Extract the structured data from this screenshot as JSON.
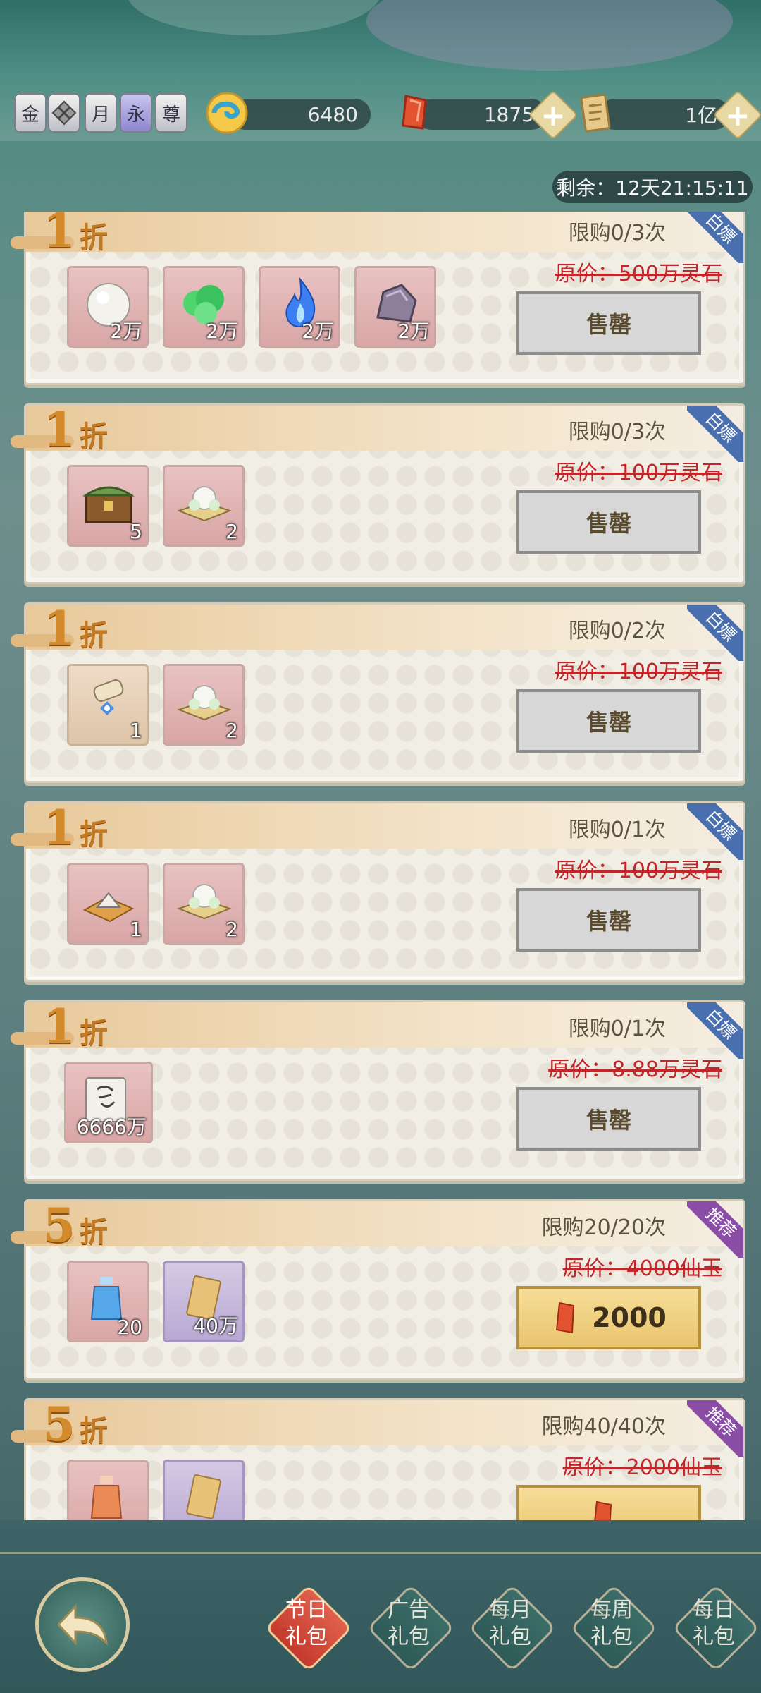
{
  "header": {
    "vip_badges": [
      "金",
      "",
      "月",
      "永",
      "尊"
    ],
    "resources": [
      {
        "icon": "jade-swirl-icon",
        "value": "6480"
      },
      {
        "icon": "red-crystal-icon",
        "value": "1875"
      },
      {
        "icon": "scroll-ticket-icon",
        "value": "1亿"
      }
    ],
    "timer": "剩余：12天21:15:11"
  },
  "packs": [
    {
      "discount": "1",
      "zhe": "折",
      "limit": "限购0/3次",
      "tag": "白嫖",
      "orig": "原价：500万灵石",
      "button": "售罄",
      "items": [
        {
          "icon": "pearl-icon",
          "qty": "2万"
        },
        {
          "icon": "green-herb-icon",
          "qty": "2万"
        },
        {
          "icon": "blue-flame-icon",
          "qty": "2万"
        },
        {
          "icon": "ore-rock-icon",
          "qty": "2万"
        }
      ]
    },
    {
      "discount": "1",
      "zhe": "折",
      "limit": "限购0/3次",
      "tag": "白嫖",
      "orig": "原价：100万灵石",
      "button": "售罄",
      "items": [
        {
          "icon": "treasure-chest-icon",
          "qty": "5"
        },
        {
          "icon": "lotus-bed-icon",
          "qty": "2"
        }
      ]
    },
    {
      "discount": "1",
      "zhe": "折",
      "limit": "限购0/2次",
      "tag": "白嫖",
      "orig": "原价：100万灵石",
      "button": "售罄",
      "items": [
        {
          "icon": "scroll-bundle-icon",
          "qty": "1"
        },
        {
          "icon": "lotus-bed-icon",
          "qty": "2"
        }
      ]
    },
    {
      "discount": "1",
      "zhe": "折",
      "limit": "限购0/1次",
      "tag": "白嫖",
      "orig": "原价：100万灵石",
      "button": "售罄",
      "items": [
        {
          "icon": "mountain-map-icon",
          "qty": "1"
        },
        {
          "icon": "lotus-bed-icon",
          "qty": "2"
        }
      ]
    },
    {
      "discount": "1",
      "zhe": "折",
      "limit": "限购0/1次",
      "tag": "白嫖",
      "orig": "原价：8.88万灵石",
      "button": "售罄",
      "items": [
        {
          "icon": "scripture-scroll-icon",
          "qty": "6666万"
        }
      ]
    },
    {
      "discount": "5",
      "zhe": "折",
      "limit": "限购20/20次",
      "tag": "推荐",
      "orig": "原价：4000仙玉",
      "button": "2000",
      "items": [
        {
          "icon": "blue-potion-icon",
          "qty": "20"
        },
        {
          "icon": "gold-card-icon",
          "qty": "40万"
        }
      ]
    },
    {
      "discount": "5",
      "zhe": "折",
      "limit": "限购40/40次",
      "tag": "推荐",
      "orig": "原价：2000仙玉",
      "button": "",
      "items": [
        {
          "icon": "orange-potion-icon",
          "qty": ""
        },
        {
          "icon": "gold-card-icon",
          "qty": ""
        }
      ]
    }
  ],
  "tabs": [
    {
      "line1": "节日",
      "line2": "礼包",
      "active": true
    },
    {
      "line1": "广告",
      "line2": "礼包",
      "active": false
    },
    {
      "line1": "每月",
      "line2": "礼包",
      "active": false
    },
    {
      "line1": "每周",
      "line2": "礼包",
      "active": false
    },
    {
      "line1": "每日",
      "line2": "礼包",
      "active": false
    }
  ],
  "colors": {
    "strike_red": "#c0262a",
    "discount_orange": "#d38a2a",
    "tag_blue": "#4a6fae",
    "tag_purple": "#8a4ea6"
  }
}
